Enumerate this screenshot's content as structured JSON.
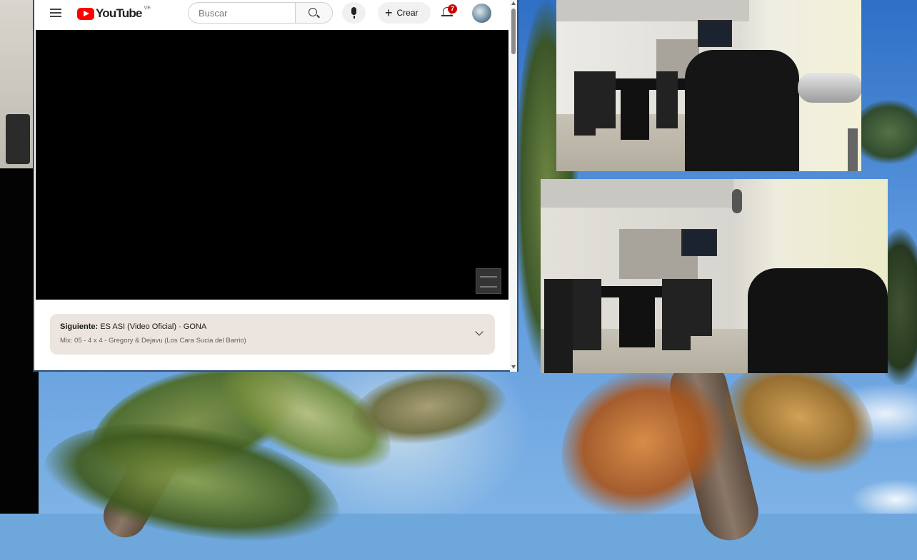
{
  "desktop": {
    "background": "palm-tree-sky-wallpaper"
  },
  "youtube": {
    "logo_text": "YouTube",
    "country_code": "VE",
    "search_placeholder": "Buscar",
    "create_label": "Crear",
    "notification_count": "7",
    "player": {
      "state": "black-video-frame"
    },
    "next_card": {
      "prefix": "Siguiente:",
      "title": "ES ASI (Video Oficial) · GONA",
      "subtitle": "Mix: 05 - 4 x 4 - Gregory & Dejavu (Los Cara Sucia del Barrio)"
    },
    "colors": {
      "brand_red": "#ff0000",
      "badge_red": "#cc0000",
      "card_bg": "#ebe4df"
    }
  },
  "icons": [
    "menu-icon",
    "youtube-logo-icon",
    "search-icon",
    "mic-icon",
    "plus-icon",
    "bell-icon",
    "avatar",
    "chevron-down-icon"
  ]
}
